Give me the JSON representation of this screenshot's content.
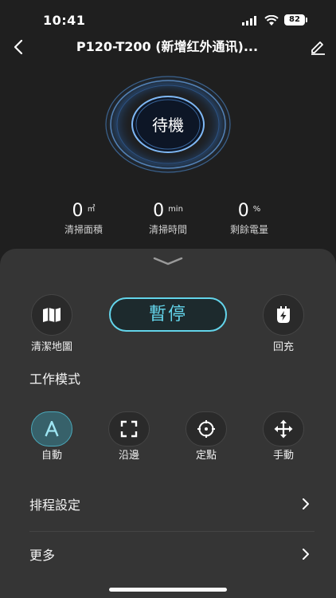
{
  "status_bar": {
    "time": "10:41",
    "battery": "82"
  },
  "header": {
    "title": "P120-T200 (新增红外通讯)..."
  },
  "robot": {
    "state": "待機"
  },
  "stats": [
    {
      "value": "0",
      "unit": "㎡",
      "label": "清掃面積"
    },
    {
      "value": "0",
      "unit": "min",
      "label": "清掃時間"
    },
    {
      "value": "0",
      "unit": "%",
      "label": "剩餘電量"
    }
  ],
  "actions": {
    "map_label": "清潔地圖",
    "pause_label": "暫停",
    "recharge_label": "回充"
  },
  "work_mode": {
    "title": "工作模式",
    "modes": [
      {
        "label": "自動",
        "icon": "auto-icon",
        "active": true
      },
      {
        "label": "沿邊",
        "icon": "edge-icon",
        "active": false
      },
      {
        "label": "定點",
        "icon": "spot-icon",
        "active": false
      },
      {
        "label": "手動",
        "icon": "manual-icon",
        "active": false
      }
    ]
  },
  "menu": [
    {
      "label": "排程設定"
    },
    {
      "label": "更多"
    }
  ],
  "colors": {
    "accent": "#63d4ea",
    "sheet": "#353535",
    "background": "#1f1f1f"
  }
}
